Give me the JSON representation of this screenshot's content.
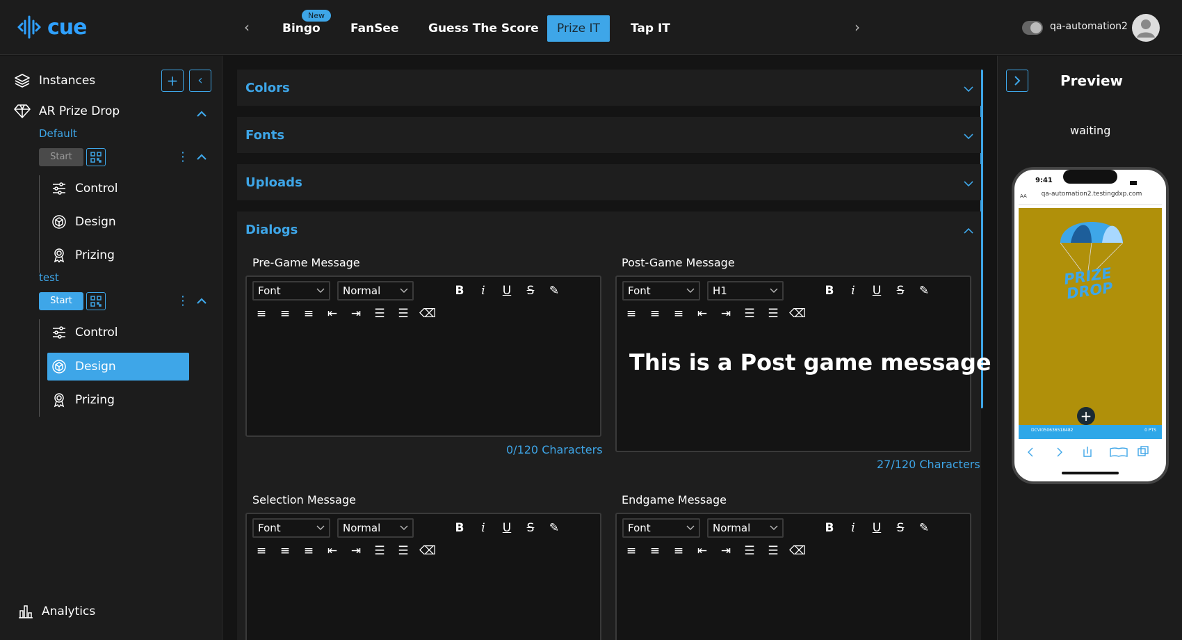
{
  "brand": {
    "name": "cue"
  },
  "topnav": {
    "tabs": [
      {
        "label": "Bingo",
        "badge": "New"
      },
      {
        "label": "FanSee"
      },
      {
        "label": "Guess The Score"
      },
      {
        "label": "Prize IT",
        "active": true
      },
      {
        "label": "Tap IT"
      }
    ],
    "username": "qa-automation2"
  },
  "sidebar": {
    "instances_label": "Instances",
    "game": "AR Prize Drop",
    "instances": [
      {
        "name": "Default",
        "start_label": "Start",
        "start_enabled": false,
        "items": [
          "Control",
          "Design",
          "Prizing"
        ]
      },
      {
        "name": "test",
        "start_label": "Start",
        "start_enabled": true,
        "items": [
          "Control",
          "Design",
          "Prizing"
        ],
        "active_item": "Design"
      }
    ],
    "analytics_label": "Analytics"
  },
  "main": {
    "sections": [
      {
        "title": "Colors",
        "expanded": false
      },
      {
        "title": "Fonts",
        "expanded": false
      },
      {
        "title": "Uploads",
        "expanded": false
      },
      {
        "title": "Dialogs",
        "expanded": true
      }
    ],
    "editors": [
      {
        "label": "Pre-Game Message",
        "font": "Font",
        "size": "Normal",
        "content": "",
        "counter": "0/120 Characters"
      },
      {
        "label": "Post-Game Message",
        "font": "Font",
        "size": "H1",
        "content": "This is a Post game message",
        "counter": "27/120 Characters"
      },
      {
        "label": "Selection Message",
        "font": "Font",
        "size": "Normal",
        "content": ""
      },
      {
        "label": "Endgame Message",
        "font": "Font",
        "size": "Normal",
        "content": ""
      }
    ]
  },
  "preview": {
    "title": "Preview",
    "status": "waiting",
    "phone_time": "9:41",
    "phone_aa": "AA",
    "phone_url": "qa-automation2.testingdxp.com",
    "phone_game": "PRIZE DROP",
    "phone_id": "DCVI050636518482",
    "phone_pts": "0 PTS",
    "screen_color": "#b0900a"
  },
  "colors": {
    "accent": "#3ea6e8",
    "bg": "#141414",
    "panel": "#1c1c1c"
  }
}
